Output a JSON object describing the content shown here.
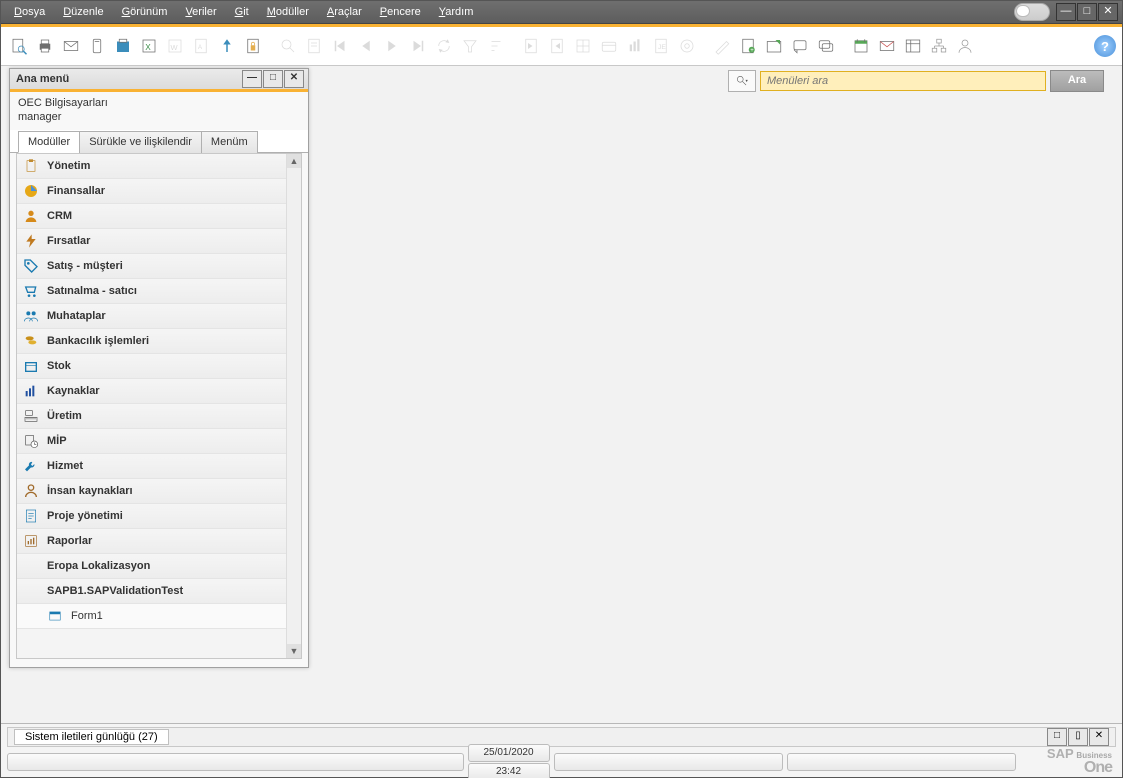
{
  "menubar": {
    "items": [
      {
        "label": "Dosya",
        "accel": "D"
      },
      {
        "label": "Düzenle",
        "accel": "D"
      },
      {
        "label": "Görünüm",
        "accel": "G"
      },
      {
        "label": "Veriler",
        "accel": "V"
      },
      {
        "label": "Git",
        "accel": "G"
      },
      {
        "label": "Modüller",
        "accel": "M"
      },
      {
        "label": "Araçlar",
        "accel": "A"
      },
      {
        "label": "Pencere",
        "accel": "P"
      },
      {
        "label": "Yardım",
        "accel": "Y"
      }
    ]
  },
  "search": {
    "placeholder": "Menüleri ara",
    "button": "Ara"
  },
  "mainmenu": {
    "title": "Ana menü",
    "company": "OEC Bilgisayarları",
    "user": "manager",
    "tabs": {
      "modules": "Modüller",
      "dragrel": "Sürükle ve ilişkilendir",
      "mymenu": "Menüm"
    },
    "items": [
      {
        "label": "Yönetim",
        "icon": "clipboard",
        "color": "#c08a2e"
      },
      {
        "label": "Finansallar",
        "icon": "pie",
        "color": "#e6a817"
      },
      {
        "label": "CRM",
        "icon": "person",
        "color": "#d68a1a"
      },
      {
        "label": "Fırsatlar",
        "icon": "thunder",
        "color": "#c07a20"
      },
      {
        "label": "Satış - müşteri",
        "icon": "tag",
        "color": "#1a7ab0"
      },
      {
        "label": "Satınalma - satıcı",
        "icon": "cart",
        "color": "#1a7ab0"
      },
      {
        "label": "Muhataplar",
        "icon": "people",
        "color": "#1a7ab0"
      },
      {
        "label": "Bankacılık işlemleri",
        "icon": "coins",
        "color": "#c9901a"
      },
      {
        "label": "Stok",
        "icon": "box",
        "color": "#1a7ab0"
      },
      {
        "label": "Kaynaklar",
        "icon": "chart",
        "color": "#2050a0"
      },
      {
        "label": "Üretim",
        "icon": "ruler",
        "color": "#555"
      },
      {
        "label": "MİP",
        "icon": "clock",
        "color": "#555"
      },
      {
        "label": "Hizmet",
        "icon": "wrench",
        "color": "#1a7ab0"
      },
      {
        "label": "İnsan kaynakları",
        "icon": "hr",
        "color": "#a06a2a"
      },
      {
        "label": "Proje yönetimi",
        "icon": "proj",
        "color": "#1a7ab0"
      },
      {
        "label": "Raporlar",
        "icon": "report",
        "color": "#a06a2a"
      },
      {
        "label": "Eropa Lokalizasyon",
        "icon": "",
        "plain": true
      },
      {
        "label": "SAPB1.SAPValidationTest",
        "icon": "",
        "plain": true
      },
      {
        "label": "Form1",
        "icon": "form",
        "sub": true
      }
    ]
  },
  "log": {
    "title": "Sistem iletileri günlüğü (27)"
  },
  "status": {
    "date": "25/01/2020",
    "time": "23:42"
  },
  "brand": {
    "line1": "Business",
    "line2": "One",
    "sap": "SAP"
  },
  "help": "?"
}
